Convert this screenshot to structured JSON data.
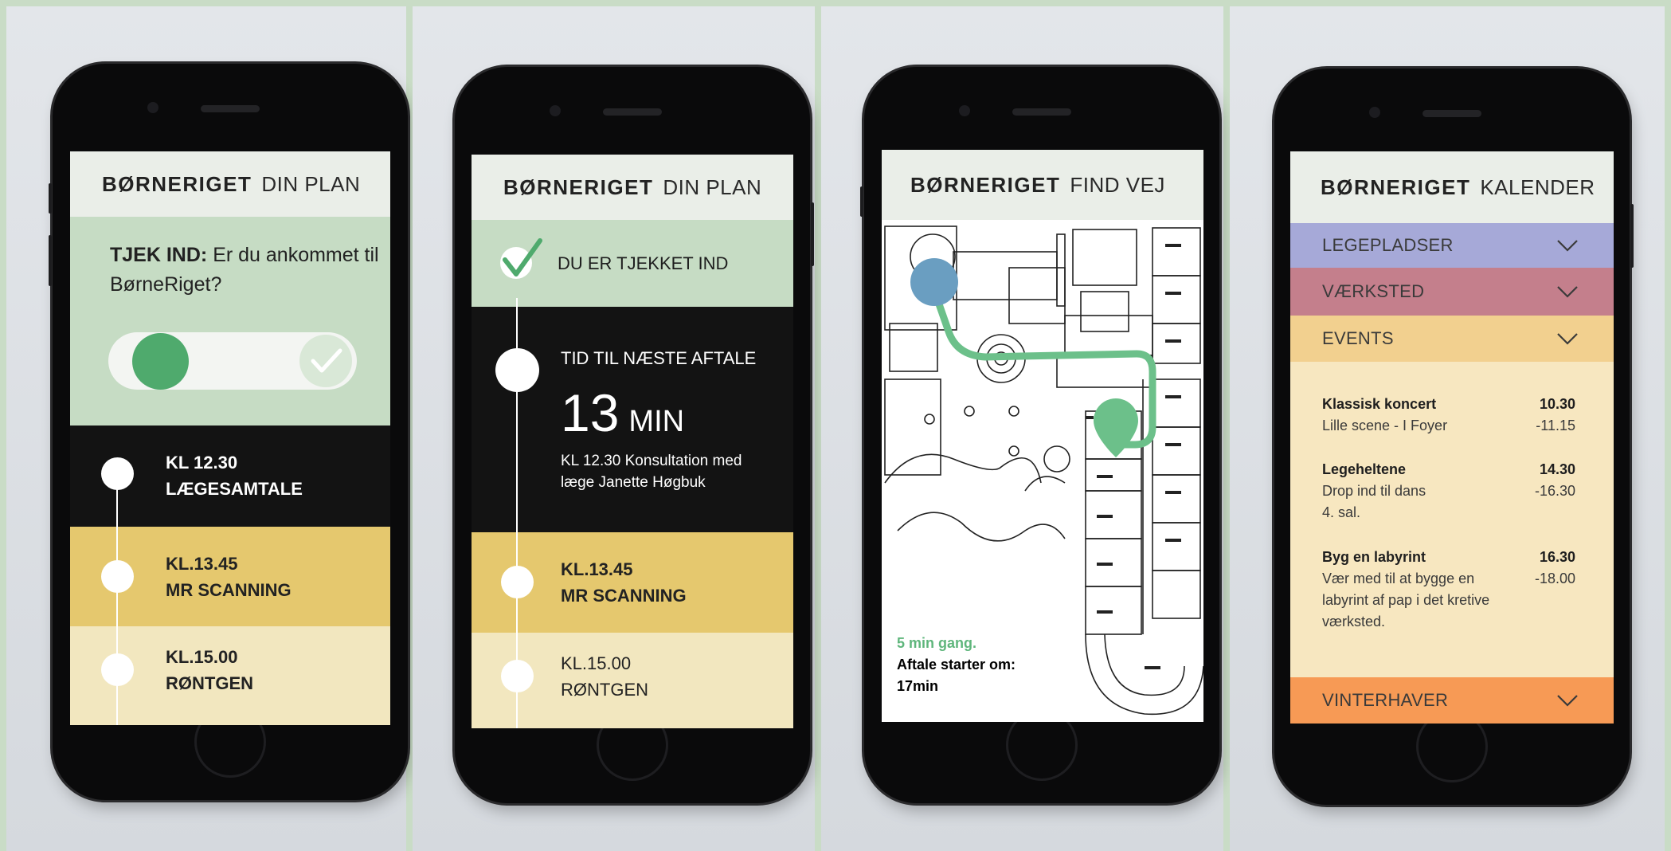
{
  "colors": {
    "green_light": "#c6dcc4",
    "green_accent": "#4faa6d",
    "dark": "#131313",
    "yellow": "#e5c86e",
    "cream": "#f2e7bf",
    "purple": "#a6a9d8",
    "rose": "#c47f8c",
    "peach": "#f2d08f",
    "orange": "#f79a55"
  },
  "screen1": {
    "brand": "BØRNERIGET",
    "section": "DIN PLAN",
    "checkin_prefix": "TJEK IND:",
    "checkin_question": "Er du ankommet til BørneRiget?",
    "appointments": [
      {
        "time": "KL 12.30",
        "title": "LÆGESAMTALE"
      },
      {
        "time": "KL.13.45",
        "title": "MR SCANNING"
      },
      {
        "time": "KL.15.00",
        "title": "RØNTGEN"
      }
    ]
  },
  "screen2": {
    "brand": "BØRNERIGET",
    "section": "DIN PLAN",
    "checked_in": "DU ER TJEKKET IND",
    "next_label": "TID TIL NÆSTE AFTALE",
    "next_number": "13",
    "next_unit": "MIN",
    "next_desc": "KL 12.30 Konsultation med læge Janette Høgbuk",
    "appointments": [
      {
        "time": "KL.13.45",
        "title": "MR SCANNING"
      },
      {
        "time": "KL.15.00",
        "title": "RØNTGEN"
      }
    ]
  },
  "screen3": {
    "brand": "BØRNERIGET",
    "section": "FIND VEJ",
    "walk_time": "5 min gang.",
    "starts_label": "Aftale starter om:",
    "starts_value": "17min"
  },
  "screen4": {
    "brand": "BØRNERIGET",
    "section": "KALENDER",
    "categories": [
      {
        "label": "LEGEPLADSER",
        "color": "#a6a9d8"
      },
      {
        "label": "VÆRKSTED",
        "color": "#c47f8c"
      },
      {
        "label": "EVENTS",
        "color": "#f2d08f"
      },
      {
        "label": "VINTERHAVER",
        "color": "#f79a55"
      }
    ],
    "events": [
      {
        "name": "Klassisk koncert",
        "desc": "Lille scene - I Foyer",
        "start": "10.30",
        "end": "-11.15"
      },
      {
        "name": "Legeheltene",
        "desc": "Drop ind til dans 4. sal.",
        "start": "14.30",
        "end": "-16.30"
      },
      {
        "name": "Byg en labyrint",
        "desc": "Vær med til at bygge en labyrint af pap i det kretive værksted.",
        "start": "16.30",
        "end": "-18.00"
      }
    ]
  }
}
